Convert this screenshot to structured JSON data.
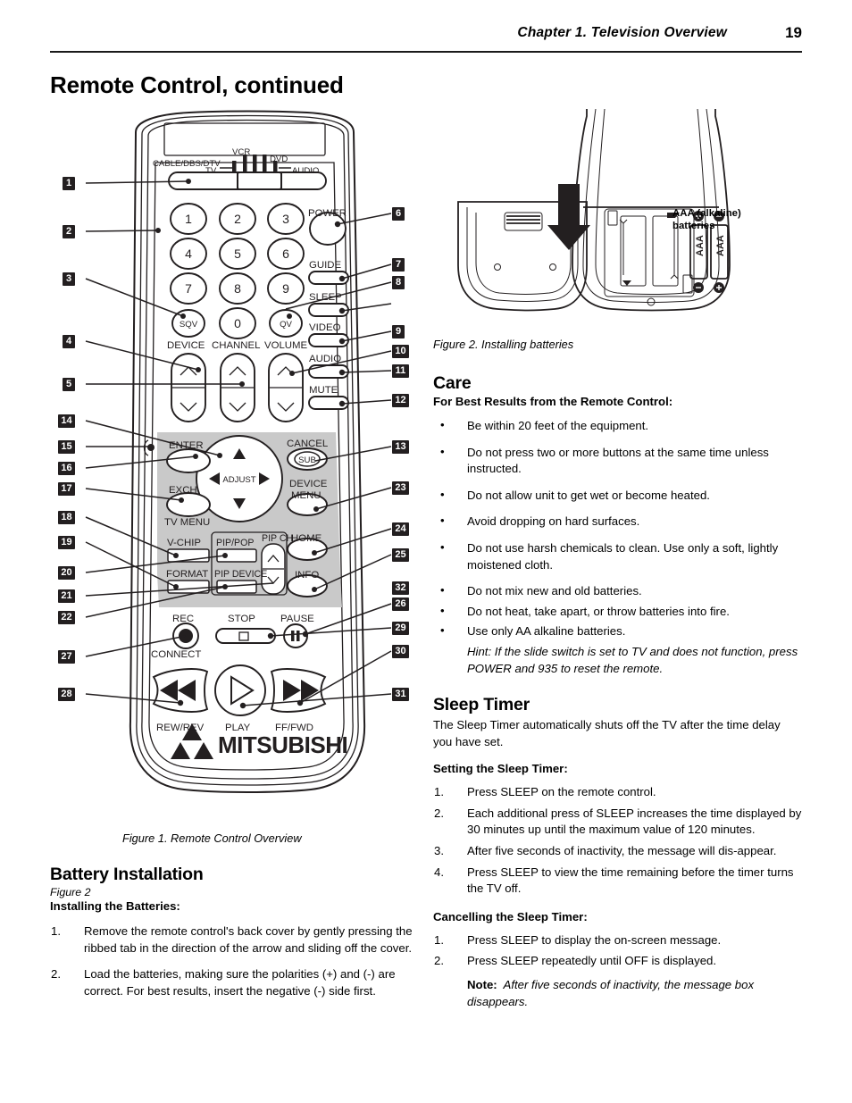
{
  "header": {
    "chapter": "Chapter 1. Television Overview",
    "page_number": "19"
  },
  "page_title": "Remote Control, continued",
  "figure1": {
    "caption": "Figure 1.  Remote Control Overview",
    "brand": "MITSUBISHI",
    "slide_switch": {
      "labels": [
        "CABLE/DBS/DTV",
        "VCR",
        "DVD",
        "TV",
        "AUDIO"
      ]
    },
    "keypad": [
      "1",
      "2",
      "3",
      "4",
      "5",
      "6",
      "7",
      "8",
      "9",
      "SQV",
      "0",
      "QV"
    ],
    "right_buttons": [
      "POWER",
      "GUIDE",
      "SLEEP",
      "VIDEO",
      "AUDIO",
      "MUTE"
    ],
    "rockers": [
      "DEVICE",
      "CHANNEL",
      "VOLUME"
    ],
    "pad_labels": {
      "enter": "ENTER",
      "exch": "EXCH",
      "tv_menu": "TV MENU",
      "adjust": "ADJUST",
      "cancel": "CANCEL",
      "sub": "SUB",
      "device_menu_line1": "DEVICE",
      "device_menu_line2": "MENU",
      "home": "HOME",
      "info": "INFO"
    },
    "pip_labels": {
      "vchip": "V-CHIP",
      "format": "FORMAT",
      "pip_pop": "PIP/POP",
      "pip_device": "PIP DEVICE",
      "pip_ch": "PIP CH"
    },
    "transport": {
      "rec": "REC",
      "stop": "STOP",
      "pause": "PAUSE",
      "connect": "CONNECT",
      "rew": "REW/REV",
      "play": "PLAY",
      "ffwd": "FF/FWD"
    },
    "callouts_left": [
      "1",
      "2",
      "3",
      "4",
      "5",
      "14",
      "15",
      "16",
      "17",
      "18",
      "19",
      "20",
      "21",
      "22",
      "27",
      "28"
    ],
    "callouts_right": [
      "6",
      "7",
      "8",
      "9",
      "10",
      "11",
      "12",
      "13",
      "23",
      "24",
      "25",
      "26",
      "29",
      "30",
      "31",
      "32"
    ]
  },
  "figure2": {
    "caption": "Figure 2.  Installing batteries",
    "battery_label_line1": "AAA (alkaline)",
    "battery_label_line2": "batteries",
    "battery_text": "AAA"
  },
  "care": {
    "heading": "Care",
    "subheading": "For Best Results from the Remote Control:",
    "bullets": [
      "Be within 20 feet of the equipment.",
      "Do not press two or more buttons at the same time unless instructed.",
      "Do not allow unit to get wet or become heated.",
      "Avoid dropping on hard surfaces.",
      "Do not use harsh chemicals to clean.  Use only a soft, lightly moistened cloth."
    ],
    "bullets_tight": [
      "Do not mix new and old batteries.",
      "Do not heat, take apart, or throw batteries into fire.",
      "Use only AA alkaline batteries."
    ],
    "hint": "Hint:  If the slide switch is set to TV  and does not function, press POWER and 935 to reset the remote."
  },
  "sleep_timer": {
    "heading": "Sleep Timer",
    "intro": "The Sleep Timer automatically shuts off the TV after the time delay you have set.",
    "setting_heading": "Setting the Sleep Timer:",
    "setting_steps": [
      "Press SLEEP on the remote control.",
      "Each additional press of SLEEP increases the time displayed by 30 minutes up until the maximum value of 120 minutes.",
      "After five seconds of inactivity, the message will dis-appear.",
      "Press SLEEP to view the time remaining before the timer turns the TV off."
    ],
    "cancel_heading": "Cancelling the Sleep Timer:",
    "cancel_steps": [
      "Press SLEEP to display the on-screen message.",
      "Press SLEEP repeatedly until OFF is displayed."
    ],
    "note_label": "Note:",
    "note_text": "After five seconds of inactivity, the message box disappears."
  },
  "battery_installation": {
    "heading": "Battery Installation",
    "figure_ref": "Figure 2",
    "subheading": "Installing the Batteries:",
    "steps": [
      "Remove the remote control's back cover by gently pressing the ribbed tab in the direction of the arrow and sliding off the cover.",
      "Load the batteries, making sure the polarities (+) and (-) are correct.  For best results, insert the negative (-) side first."
    ]
  }
}
